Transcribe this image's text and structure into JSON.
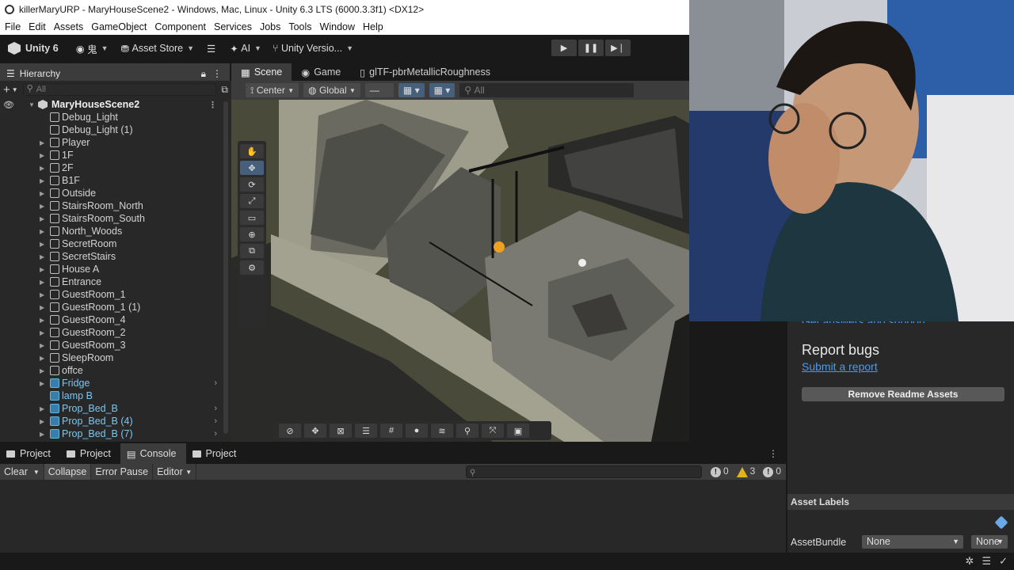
{
  "window": {
    "title": "killerMaryURP - MaryHouseScene2 - Windows, Mac, Linux - Unity 6.3 LTS (6000.3.3f1) <DX12>"
  },
  "menu": [
    "File",
    "Edit",
    "Assets",
    "GameObject",
    "Component",
    "Services",
    "Jobs",
    "Tools",
    "Window",
    "Help"
  ],
  "toolbar": {
    "unity_label": "Unity 6",
    "account_label": "鬼",
    "asset_store_label": "Asset Store",
    "ai_label": "AI",
    "version_control_label": "Unity Versio..."
  },
  "hierarchy": {
    "tab_label": "Hierarchy",
    "search_placeholder": "All",
    "scene_name": "MaryHouseScene2",
    "items": [
      {
        "label": "Debug_Light",
        "expandable": false,
        "prefab": false
      },
      {
        "label": "Debug_Light (1)",
        "expandable": false,
        "prefab": false
      },
      {
        "label": "Player",
        "expandable": true,
        "prefab": false
      },
      {
        "label": "1F",
        "expandable": true,
        "prefab": false
      },
      {
        "label": "2F",
        "expandable": true,
        "prefab": false
      },
      {
        "label": "B1F",
        "expandable": true,
        "prefab": false
      },
      {
        "label": "Outside",
        "expandable": true,
        "prefab": false
      },
      {
        "label": "StairsRoom_North",
        "expandable": true,
        "prefab": false
      },
      {
        "label": "StairsRoom_South",
        "expandable": true,
        "prefab": false
      },
      {
        "label": "North_Woods",
        "expandable": true,
        "prefab": false
      },
      {
        "label": "SecretRoom",
        "expandable": true,
        "prefab": false
      },
      {
        "label": "SecretStairs",
        "expandable": true,
        "prefab": false
      },
      {
        "label": "House A",
        "expandable": true,
        "prefab": false
      },
      {
        "label": "Entrance",
        "expandable": true,
        "prefab": false
      },
      {
        "label": "GuestRoom_1",
        "expandable": true,
        "prefab": false
      },
      {
        "label": "GuestRoom_1 (1)",
        "expandable": true,
        "prefab": false
      },
      {
        "label": "GuestRoom_4",
        "expandable": true,
        "prefab": false
      },
      {
        "label": "GuestRoom_2",
        "expandable": true,
        "prefab": false
      },
      {
        "label": "GuestRoom_3",
        "expandable": true,
        "prefab": false
      },
      {
        "label": "SleepRoom",
        "expandable": true,
        "prefab": false
      },
      {
        "label": "offce",
        "expandable": true,
        "prefab": false
      },
      {
        "label": "Fridge",
        "expandable": true,
        "prefab": true
      },
      {
        "label": "lamp B",
        "expandable": false,
        "prefab": true
      },
      {
        "label": "Prop_Bed_B",
        "expandable": true,
        "prefab": true
      },
      {
        "label": "Prop_Bed_B (4)",
        "expandable": true,
        "prefab": true
      },
      {
        "label": "Prop_Bed_B (7)",
        "expandable": true,
        "prefab": true
      }
    ]
  },
  "scene_view": {
    "tabs": [
      "Scene",
      "Game",
      "glTF-pbrMetallicRoughness"
    ],
    "pivot_label": "Center",
    "space_label": "Global",
    "search_placeholder": "All"
  },
  "console": {
    "tabs": [
      "Project",
      "Project",
      "Console",
      "Project"
    ],
    "buttons": {
      "clear": "Clear",
      "collapse": "Collapse",
      "error_pause": "Error Pause",
      "editor": "Editor"
    },
    "counts": {
      "errors": "0",
      "warnings": "3",
      "logs": "0"
    }
  },
  "inspector": {
    "cut_link": "Get answers and support",
    "report_heading": "Report bugs",
    "report_link": "Submit a report",
    "remove_button": "Remove Readme Assets",
    "asset_labels": "Asset Labels",
    "asset_bundle_label": "AssetBundle",
    "bundle_value": "None",
    "variant_value": "None"
  },
  "colors": {
    "accent_blue": "#4c9ae9",
    "prefab_blue": "#7cc7f0",
    "warning": "#e2b31c"
  }
}
